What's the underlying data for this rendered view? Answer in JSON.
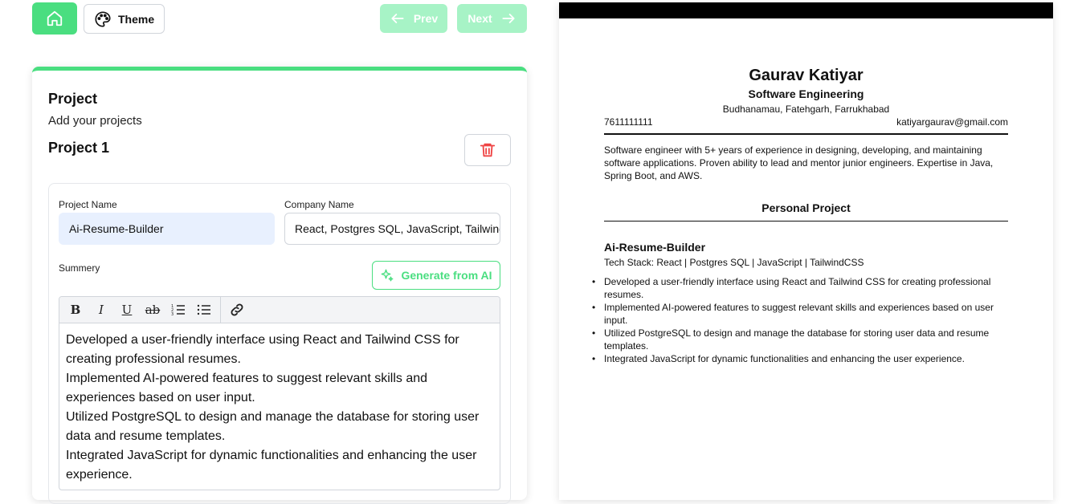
{
  "header": {
    "theme_label": "Theme",
    "prev_label": "Prev",
    "next_label": "Next"
  },
  "form": {
    "title": "Project",
    "subtitle": "Add your projects",
    "project_heading": "Project 1",
    "project_name_label": "Project Name",
    "project_name_value": "Ai-Resume-Builder",
    "company_name_label": "Company Name",
    "company_name_value": "React, Postgres SQL, JavaScript, Tailwind",
    "summary_label": "Summery",
    "generate_label": "Generate from AI",
    "toolbar": {
      "bold": "B",
      "italic": "I",
      "underline": "U",
      "strike": "ab"
    },
    "summary_lines": [
      "Developed a user-friendly interface using React and Tailwind CSS for creating professional resumes.",
      "Implemented AI-powered features to suggest relevant skills and experiences based on user input.",
      "Utilized PostgreSQL to design and manage the database for storing user data and resume templates.",
      "Integrated JavaScript for dynamic functionalities and enhancing the user experience."
    ]
  },
  "resume": {
    "name": "Gaurav Katiyar",
    "role": "Software Engineering",
    "address": "Budhanamau, Fatehgarh, Farrukhabad",
    "phone": "7611111111",
    "email": "katiyargaurav@gmail.com",
    "summary": "Software engineer with 5+ years of experience in designing, developing, and maintaining software applications. Proven ability to lead and mentor junior engineers. Expertise in Java, Spring Boot, and AWS.",
    "section_title": "Personal Project",
    "project_title": "Ai-Resume-Builder",
    "tech_stack": "Tech Stack: React | Postgres SQL | JavaScript | TailwindCSS",
    "bullets": [
      "Developed a user-friendly interface using React and Tailwind CSS for creating professional resumes.",
      "Implemented AI-powered features to suggest relevant skills and experiences based on user input.",
      "Utilized PostgreSQL to design and manage the database for storing user data and resume templates.",
      "Integrated JavaScript for dynamic functionalities and enhancing the user experience."
    ]
  },
  "colors": {
    "accent": "#4ade80",
    "accent_light": "#a7f3c6",
    "delete": "#ef4444",
    "input_highlight": "#e8f0fe"
  },
  "icons": {
    "home": "home-icon",
    "theme": "palette-icon",
    "prev": "arrow-left-icon",
    "next": "arrow-right-icon",
    "delete": "trash-icon",
    "generate": "sparkles-icon",
    "ordered_list": "ordered-list-icon",
    "bullet_list": "bullet-list-icon",
    "link": "link-icon"
  }
}
